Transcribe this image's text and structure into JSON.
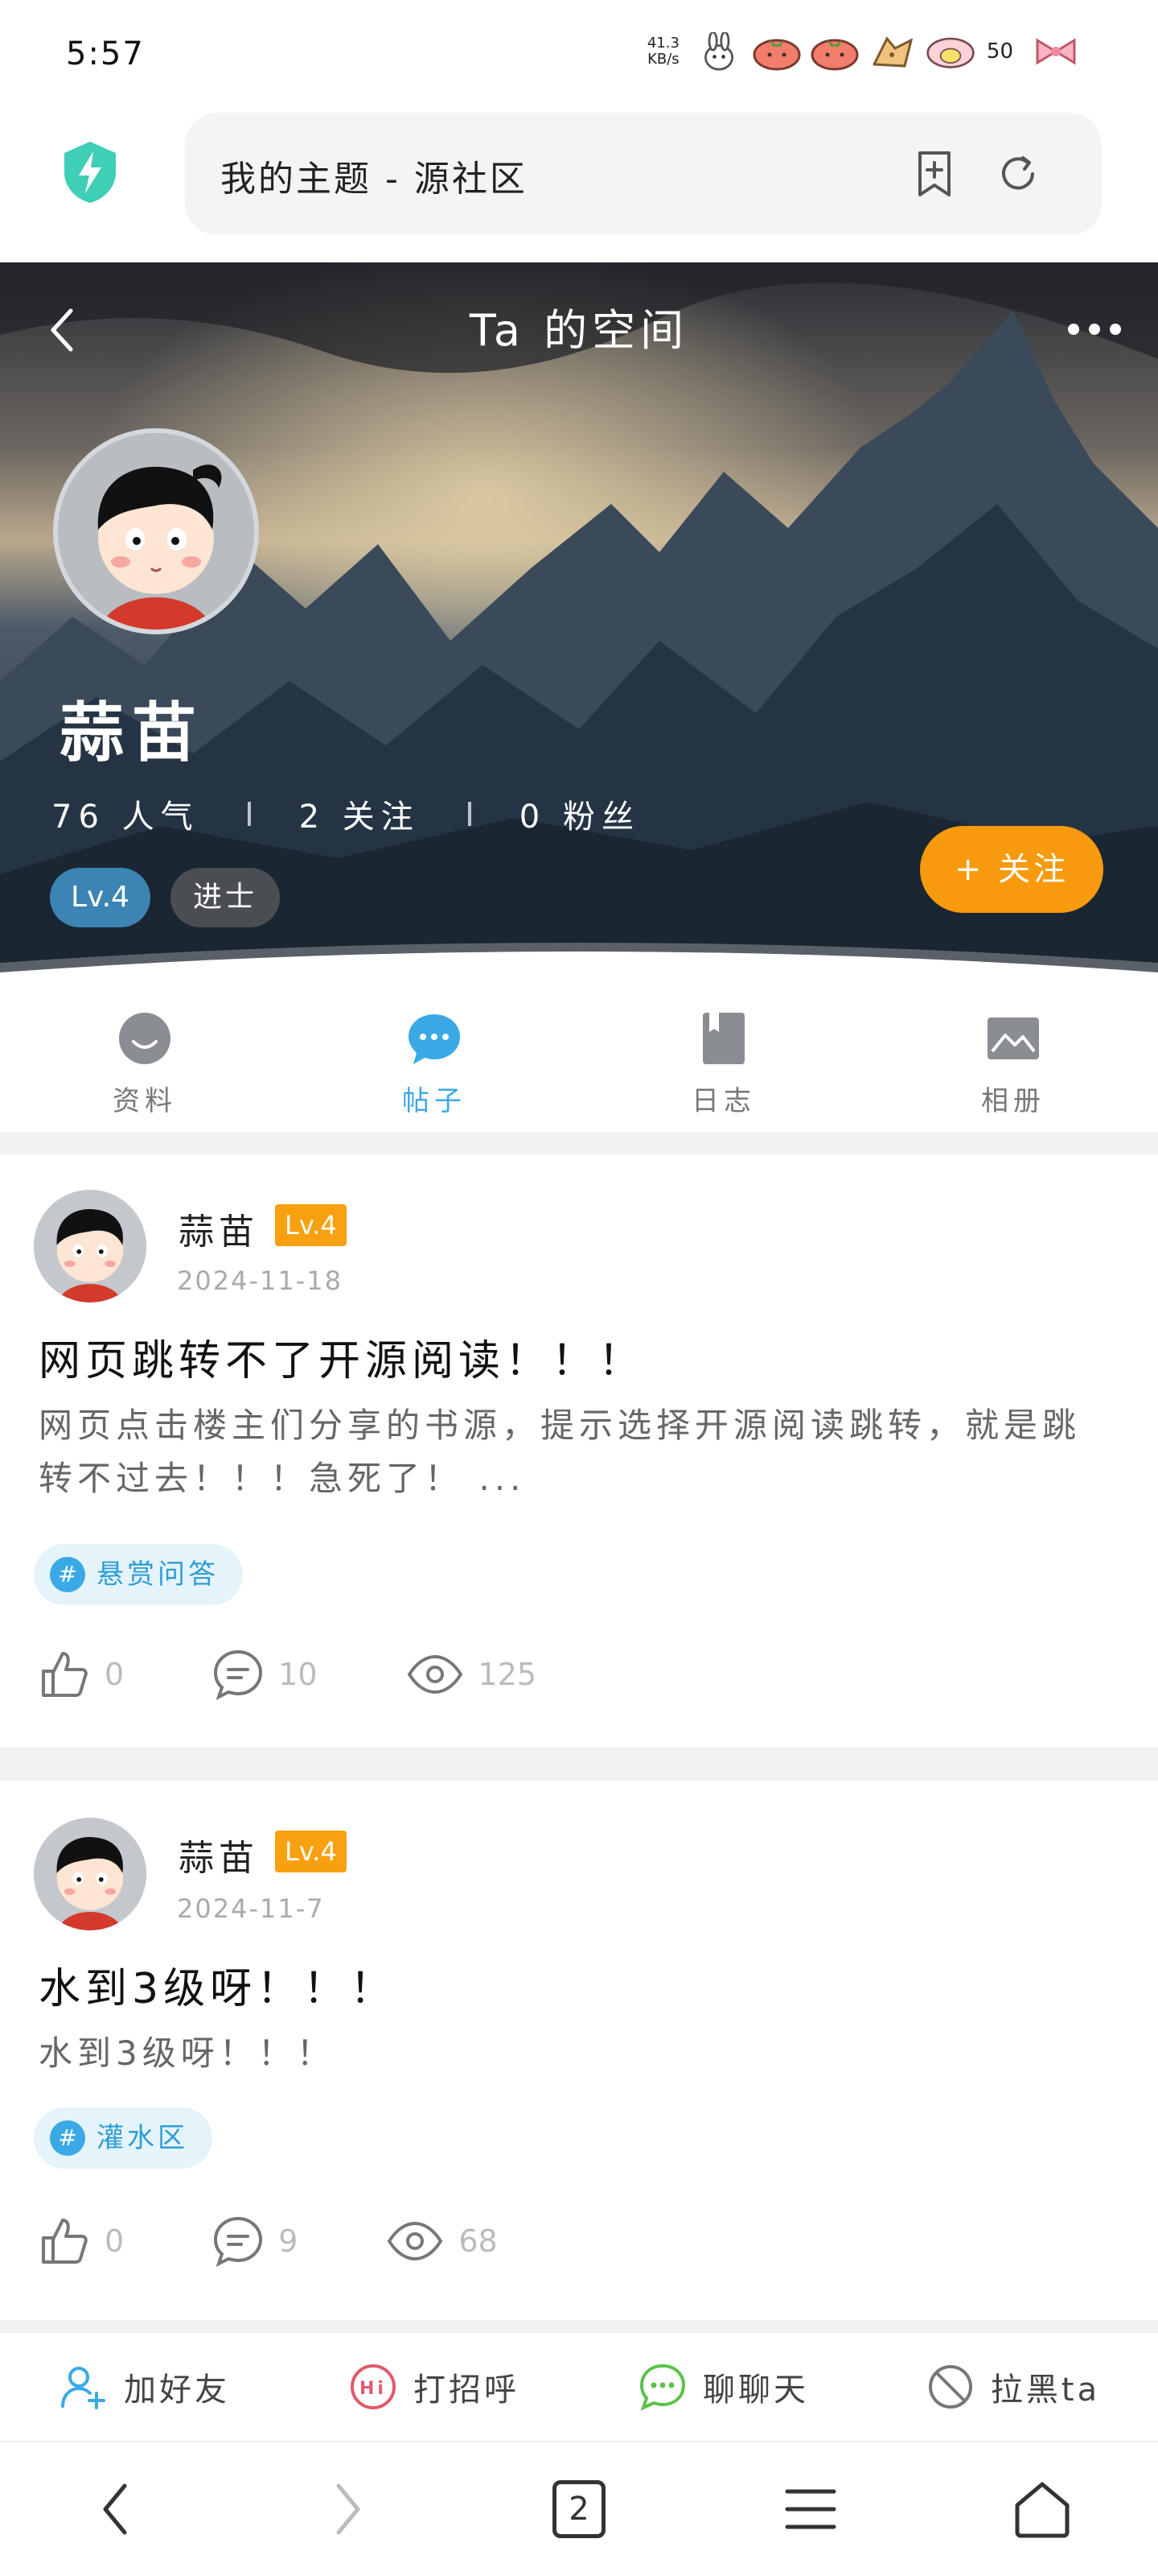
{
  "status_bar": {
    "time": "5:57",
    "net_speed_value": "41.3",
    "net_speed_unit": "KB/s",
    "battery": "50"
  },
  "browser": {
    "url_title": "我的主题 - 源社区"
  },
  "profile": {
    "header_title": "Ta 的空间",
    "username": "蒜苗",
    "popularity": "76 人气",
    "following": "2 关注",
    "followers": "0 粉丝",
    "level": "Lv.4",
    "rank": "进士",
    "follow_label": "+ 关注"
  },
  "tabs": [
    {
      "label": "资料",
      "icon": "smile-icon"
    },
    {
      "label": "帖子",
      "icon": "chat-bubble-icon"
    },
    {
      "label": "日志",
      "icon": "bookmark-note-icon"
    },
    {
      "label": "相册",
      "icon": "image-icon"
    }
  ],
  "posts": [
    {
      "author": "蒜苗",
      "level": "Lv.4",
      "date": "2024-11-18",
      "title": "网页跳转不了开源阅读！！！",
      "body": "网页点击楼主们分享的书源，提示选择开源阅读跳转，就是跳转不过去！！！急死了！ ...",
      "tag": "悬赏问答",
      "likes": "0",
      "comments": "10",
      "views": "125"
    },
    {
      "author": "蒜苗",
      "level": "Lv.4",
      "date": "2024-11-7",
      "title": "水到3级呀！！！",
      "body": "水到3级呀！！！",
      "tag": "灌水区",
      "likes": "0",
      "comments": "9",
      "views": "68"
    }
  ],
  "bottom_actions": [
    {
      "label": "加好友",
      "icon": "add-friend-icon"
    },
    {
      "label": "打招呼",
      "icon": "hi-icon"
    },
    {
      "label": "聊聊天",
      "icon": "chat-icon"
    },
    {
      "label": "拉黑ta",
      "icon": "block-icon"
    }
  ],
  "nav": {
    "tab_count": "2"
  },
  "colors": {
    "accent_blue": "#3aa9e6",
    "follow_orange": "#f89a0e",
    "level_orange": "#f8a010"
  }
}
